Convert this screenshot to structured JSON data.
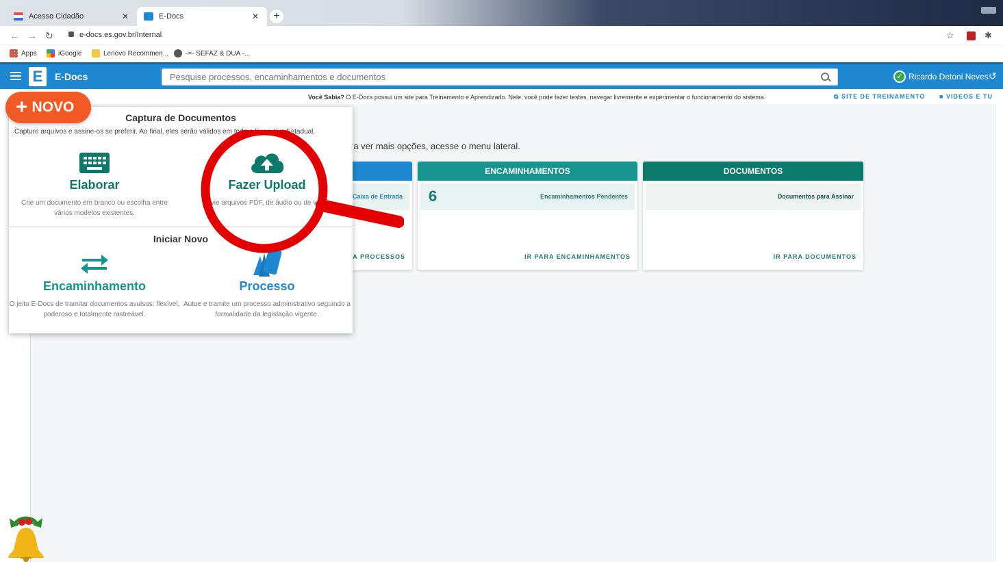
{
  "browser": {
    "tabs": [
      {
        "title": "Acesso Cidadão",
        "active": false
      },
      {
        "title": "E-Docs",
        "active": true
      }
    ],
    "url": "e-docs.es.gov.br/Internal",
    "bookmarks": [
      "Apps",
      "iGoogle",
      "Lenovo Recommen...",
      "-=- SEFAZ & DUA -..."
    ]
  },
  "app": {
    "name": "E-Docs",
    "logo_letter": "E",
    "search_placeholder": "Pesquise processos, encaminhamentos e documentos",
    "user_name": "Ricardo Detoni Neves",
    "accent": "#1e88d2"
  },
  "info": {
    "label": "Você Sabia?",
    "text": "O E-Docs possui um site para Treinamento e Aprendizado. Nele, você pode fazer testes, navegar livremente e experimentar o funcionamento do sistema.",
    "link_training": "SITE DE TREINAMENTO",
    "link_videos": "VIDEOS E TU"
  },
  "main": {
    "hint": "ra ver mais opções, acesse o menu lateral.",
    "cards": [
      {
        "header": "",
        "row_label": "Caixa de Entrada",
        "count": "",
        "link": "RA PROCESSOS",
        "color": "#1e88d2"
      },
      {
        "header": "ENCAMINHAMENTOS",
        "row_label": "Encaminhamentos Pendentes",
        "count": "6",
        "link": "IR PARA ENCAMINHAMENTOS",
        "color": "#17948f"
      },
      {
        "header": "DOCUMENTOS",
        "row_label": "Documentos para Assinar",
        "count": "",
        "link": "IR PARA DOCUMENTOS",
        "color": "#0c7a6a"
      }
    ]
  },
  "novo": {
    "button_label": "NOVO",
    "capture_title": "Captura de Documentos",
    "capture_subtitle": "Capture arquivos e assine-os se preferir. Ao final, eles serão válidos em todo o Executivo Estadual.",
    "elaborar_title": "Elaborar",
    "elaborar_desc": "Crie um documento em branco ou escolha entre vários modelos existentes.",
    "upload_title": "Fazer Upload",
    "upload_desc": "Envie arquivos PDF, de áudio ou de vídeo.",
    "start_title": "Iniciar Novo",
    "encaminhamento_title": "Encaminhamento",
    "encaminhamento_desc": "O jeito E-Docs de tramitar documentos avulsos: flexível, poderoso e totalmente rastreável.",
    "processo_title": "Processo",
    "processo_desc": "Autue e tramite um processo administrativo seguindo a formalidade da legislação vigente.",
    "colors": {
      "elaborar": "#0c7a6a",
      "upload": "#0c7a6a",
      "encaminhamento": "#17948f",
      "processo": "#1e88d2"
    }
  }
}
